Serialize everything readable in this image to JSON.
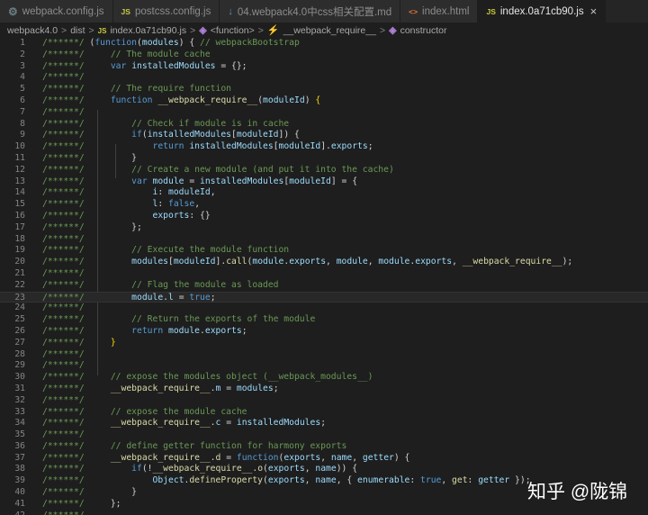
{
  "tabs": [
    {
      "label": "webpack.config.js",
      "icon": "gear-icon",
      "color": "#6d8086",
      "active": false
    },
    {
      "label": "postcss.config.js",
      "icon": "JS",
      "color": "#cbcb41",
      "active": false
    },
    {
      "label": "04.webpack4.0中css相关配置.md",
      "icon": "↓",
      "color": "#519aba",
      "active": false
    },
    {
      "label": "index.html",
      "icon": "<>",
      "color": "#e37933",
      "active": false
    },
    {
      "label": "index.0a71cb90.js",
      "icon": "JS",
      "color": "#cbcb41",
      "active": true,
      "close": "×"
    }
  ],
  "breadcrumb": {
    "sep": ">",
    "parts": [
      {
        "text": "webpack4.0"
      },
      {
        "text": "dist"
      },
      {
        "text": "index.0a71cb90.js",
        "icon": "JS",
        "color": "#cbcb41"
      },
      {
        "text": "<function>",
        "icon": "cube-icon",
        "color": "#b180d7"
      },
      {
        "text": "__webpack_require__",
        "icon": "variable-icon",
        "color": "#ee9d28"
      },
      {
        "text": "constructor",
        "icon": "cube-icon",
        "color": "#b180d7"
      }
    ]
  },
  "highlight_line": 23,
  "lines": [
    [
      [
        "c",
        "/******/ "
      ],
      [
        "p",
        "("
      ],
      [
        "k",
        "function"
      ],
      [
        "p",
        "("
      ],
      [
        "v",
        "modules"
      ],
      [
        "p",
        ") { "
      ],
      [
        "c",
        "// webpackBootstrap"
      ]
    ],
    [
      [
        "c",
        "/******/ "
      ],
      [
        "p",
        "    "
      ],
      [
        "c",
        "// The module cache"
      ]
    ],
    [
      [
        "c",
        "/******/ "
      ],
      [
        "p",
        "    "
      ],
      [
        "k",
        "var"
      ],
      [
        "p",
        " "
      ],
      [
        "v",
        "installedModules"
      ],
      [
        "p",
        " = {};"
      ]
    ],
    [
      [
        "c",
        "/******/"
      ]
    ],
    [
      [
        "c",
        "/******/ "
      ],
      [
        "p",
        "    "
      ],
      [
        "c",
        "// The require function"
      ]
    ],
    [
      [
        "c",
        "/******/ "
      ],
      [
        "p",
        "    "
      ],
      [
        "k",
        "function"
      ],
      [
        "p",
        " "
      ],
      [
        "f",
        "__webpack_require__"
      ],
      [
        "p",
        "("
      ],
      [
        "v",
        "moduleId"
      ],
      [
        "p",
        ") "
      ],
      [
        "b",
        "{"
      ]
    ],
    [
      [
        "c",
        "/******/"
      ]
    ],
    [
      [
        "c",
        "/******/ "
      ],
      [
        "p",
        "        "
      ],
      [
        "c",
        "// Check if module is in cache"
      ]
    ],
    [
      [
        "c",
        "/******/ "
      ],
      [
        "p",
        "        "
      ],
      [
        "k",
        "if"
      ],
      [
        "p",
        "("
      ],
      [
        "v",
        "installedModules"
      ],
      [
        "p",
        "["
      ],
      [
        "v",
        "moduleId"
      ],
      [
        "p",
        "]) {"
      ]
    ],
    [
      [
        "c",
        "/******/ "
      ],
      [
        "p",
        "            "
      ],
      [
        "k",
        "return"
      ],
      [
        "p",
        " "
      ],
      [
        "v",
        "installedModules"
      ],
      [
        "p",
        "["
      ],
      [
        "v",
        "moduleId"
      ],
      [
        "p",
        "]."
      ],
      [
        "v",
        "exports"
      ],
      [
        "p",
        ";"
      ]
    ],
    [
      [
        "c",
        "/******/ "
      ],
      [
        "p",
        "        }"
      ]
    ],
    [
      [
        "c",
        "/******/ "
      ],
      [
        "p",
        "        "
      ],
      [
        "c",
        "// Create a new module (and put it into the cache)"
      ]
    ],
    [
      [
        "c",
        "/******/ "
      ],
      [
        "p",
        "        "
      ],
      [
        "k",
        "var"
      ],
      [
        "p",
        " "
      ],
      [
        "v",
        "module"
      ],
      [
        "p",
        " = "
      ],
      [
        "v",
        "installedModules"
      ],
      [
        "p",
        "["
      ],
      [
        "v",
        "moduleId"
      ],
      [
        "p",
        "] = {"
      ]
    ],
    [
      [
        "c",
        "/******/ "
      ],
      [
        "p",
        "            "
      ],
      [
        "v",
        "i"
      ],
      [
        "p",
        ": "
      ],
      [
        "v",
        "moduleId"
      ],
      [
        "p",
        ","
      ]
    ],
    [
      [
        "c",
        "/******/ "
      ],
      [
        "p",
        "            "
      ],
      [
        "v",
        "l"
      ],
      [
        "p",
        ": "
      ],
      [
        "k",
        "false"
      ],
      [
        "p",
        ","
      ]
    ],
    [
      [
        "c",
        "/******/ "
      ],
      [
        "p",
        "            "
      ],
      [
        "v",
        "exports"
      ],
      [
        "p",
        ": {}"
      ]
    ],
    [
      [
        "c",
        "/******/ "
      ],
      [
        "p",
        "        };"
      ]
    ],
    [
      [
        "c",
        "/******/"
      ]
    ],
    [
      [
        "c",
        "/******/ "
      ],
      [
        "p",
        "        "
      ],
      [
        "c",
        "// Execute the module function"
      ]
    ],
    [
      [
        "c",
        "/******/ "
      ],
      [
        "p",
        "        "
      ],
      [
        "v",
        "modules"
      ],
      [
        "p",
        "["
      ],
      [
        "v",
        "moduleId"
      ],
      [
        "p",
        "]."
      ],
      [
        "f",
        "call"
      ],
      [
        "p",
        "("
      ],
      [
        "v",
        "module"
      ],
      [
        "p",
        "."
      ],
      [
        "v",
        "exports"
      ],
      [
        "p",
        ", "
      ],
      [
        "v",
        "module"
      ],
      [
        "p",
        ", "
      ],
      [
        "v",
        "module"
      ],
      [
        "p",
        "."
      ],
      [
        "v",
        "exports"
      ],
      [
        "p",
        ", "
      ],
      [
        "f",
        "__webpack_require__"
      ],
      [
        "p",
        ");"
      ]
    ],
    [
      [
        "c",
        "/******/"
      ]
    ],
    [
      [
        "c",
        "/******/ "
      ],
      [
        "p",
        "        "
      ],
      [
        "c",
        "// Flag the module as loaded"
      ]
    ],
    [
      [
        "c",
        "/******/ "
      ],
      [
        "p",
        "        "
      ],
      [
        "v",
        "module"
      ],
      [
        "p",
        "."
      ],
      [
        "v",
        "l"
      ],
      [
        "p",
        " = "
      ],
      [
        "k",
        "true"
      ],
      [
        "p",
        ";"
      ]
    ],
    [
      [
        "c",
        "/******/"
      ]
    ],
    [
      [
        "c",
        "/******/ "
      ],
      [
        "p",
        "        "
      ],
      [
        "c",
        "// Return the exports of the module"
      ]
    ],
    [
      [
        "c",
        "/******/ "
      ],
      [
        "p",
        "        "
      ],
      [
        "k",
        "return"
      ],
      [
        "p",
        " "
      ],
      [
        "v",
        "module"
      ],
      [
        "p",
        "."
      ],
      [
        "v",
        "exports"
      ],
      [
        "p",
        ";"
      ]
    ],
    [
      [
        "c",
        "/******/ "
      ],
      [
        "p",
        "    "
      ],
      [
        "b",
        "}"
      ]
    ],
    [
      [
        "c",
        "/******/"
      ]
    ],
    [
      [
        "c",
        "/******/"
      ]
    ],
    [
      [
        "c",
        "/******/ "
      ],
      [
        "p",
        "    "
      ],
      [
        "c",
        "// expose the modules object (__webpack_modules__)"
      ]
    ],
    [
      [
        "c",
        "/******/ "
      ],
      [
        "p",
        "    "
      ],
      [
        "f",
        "__webpack_require__"
      ],
      [
        "p",
        "."
      ],
      [
        "v",
        "m"
      ],
      [
        "p",
        " = "
      ],
      [
        "v",
        "modules"
      ],
      [
        "p",
        ";"
      ]
    ],
    [
      [
        "c",
        "/******/"
      ]
    ],
    [
      [
        "c",
        "/******/ "
      ],
      [
        "p",
        "    "
      ],
      [
        "c",
        "// expose the module cache"
      ]
    ],
    [
      [
        "c",
        "/******/ "
      ],
      [
        "p",
        "    "
      ],
      [
        "f",
        "__webpack_require__"
      ],
      [
        "p",
        "."
      ],
      [
        "v",
        "c"
      ],
      [
        "p",
        " = "
      ],
      [
        "v",
        "installedModules"
      ],
      [
        "p",
        ";"
      ]
    ],
    [
      [
        "c",
        "/******/"
      ]
    ],
    [
      [
        "c",
        "/******/ "
      ],
      [
        "p",
        "    "
      ],
      [
        "c",
        "// define getter function for harmony exports"
      ]
    ],
    [
      [
        "c",
        "/******/ "
      ],
      [
        "p",
        "    "
      ],
      [
        "f",
        "__webpack_require__"
      ],
      [
        "p",
        "."
      ],
      [
        "f",
        "d"
      ],
      [
        "p",
        " = "
      ],
      [
        "k",
        "function"
      ],
      [
        "p",
        "("
      ],
      [
        "v",
        "exports"
      ],
      [
        "p",
        ", "
      ],
      [
        "v",
        "name"
      ],
      [
        "p",
        ", "
      ],
      [
        "v",
        "getter"
      ],
      [
        "p",
        ") {"
      ]
    ],
    [
      [
        "c",
        "/******/ "
      ],
      [
        "p",
        "        "
      ],
      [
        "k",
        "if"
      ],
      [
        "p",
        "(!"
      ],
      [
        "f",
        "__webpack_require__"
      ],
      [
        "p",
        "."
      ],
      [
        "f",
        "o"
      ],
      [
        "p",
        "("
      ],
      [
        "v",
        "exports"
      ],
      [
        "p",
        ", "
      ],
      [
        "v",
        "name"
      ],
      [
        "p",
        ")) {"
      ]
    ],
    [
      [
        "c",
        "/******/ "
      ],
      [
        "p",
        "            "
      ],
      [
        "v",
        "Object"
      ],
      [
        "p",
        "."
      ],
      [
        "f",
        "defineProperty"
      ],
      [
        "p",
        "("
      ],
      [
        "v",
        "exports"
      ],
      [
        "p",
        ", "
      ],
      [
        "v",
        "name"
      ],
      [
        "p",
        ", { "
      ],
      [
        "v",
        "enumerable"
      ],
      [
        "p",
        ": "
      ],
      [
        "k",
        "true"
      ],
      [
        "p",
        ", "
      ],
      [
        "f",
        "get"
      ],
      [
        "p",
        ": "
      ],
      [
        "v",
        "getter"
      ],
      [
        "p",
        " });"
      ]
    ],
    [
      [
        "c",
        "/******/ "
      ],
      [
        "p",
        "        }"
      ]
    ],
    [
      [
        "c",
        "/******/ "
      ],
      [
        "p",
        "    };"
      ]
    ],
    [
      [
        "c",
        "/******/"
      ]
    ]
  ],
  "watermark": "知乎 @陇锦"
}
